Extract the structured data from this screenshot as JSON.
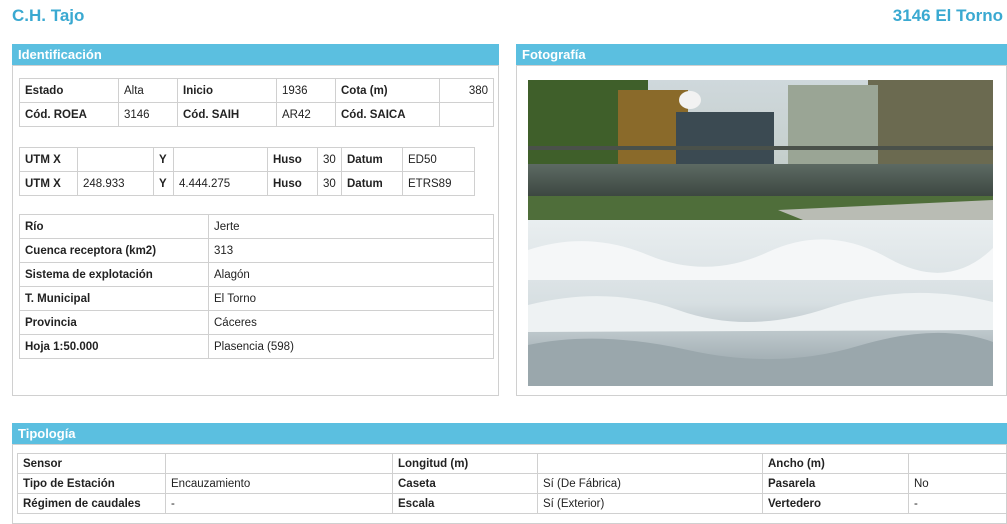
{
  "header": {
    "basin": "C.H. Tajo",
    "station": "3146 El Torno"
  },
  "identificacion": {
    "title": "Identificación",
    "row1": {
      "estado_label": "Estado",
      "estado": "Alta",
      "inicio_label": "Inicio",
      "inicio": "1936",
      "cota_label": "Cota (m)",
      "cota": "380"
    },
    "row2": {
      "roea_label": "Cód. ROEA",
      "roea": "3146",
      "saih_label": "Cód. SAIH",
      "saih": "AR42",
      "saica_label": "Cód. SAICA",
      "saica": ""
    },
    "utm1": {
      "x_label": "UTM X",
      "x": "",
      "y_label": "Y",
      "y": "",
      "huso_label": "Huso",
      "huso": "30",
      "datum_label": "Datum",
      "datum": "ED50"
    },
    "utm2": {
      "x_label": "UTM X",
      "x": "248.933",
      "y_label": "Y",
      "y": "4.444.275",
      "huso_label": "Huso",
      "huso": "30",
      "datum_label": "Datum",
      "datum": "ETRS89"
    },
    "info": [
      {
        "label": "Río",
        "value": "Jerte"
      },
      {
        "label": "Cuenca receptora (km2)",
        "value": "313"
      },
      {
        "label": "Sistema de explotación",
        "value": "Alagón"
      },
      {
        "label": "T. Municipal",
        "value": "El Torno"
      },
      {
        "label": "Provincia",
        "value": "Cáceres"
      },
      {
        "label": "Hoja 1:50.000",
        "value": "Plasencia (598)"
      }
    ]
  },
  "fotografia": {
    "title": "Fotografía"
  },
  "tipologia": {
    "title": "Tipología",
    "rows": [
      [
        "Sensor",
        "",
        "Longitud (m)",
        "",
        "Ancho (m)",
        ""
      ],
      [
        "Tipo de Estación",
        "Encauzamiento",
        "Caseta",
        "Sí (De Fábrica)",
        "Pasarela",
        "No"
      ],
      [
        "Régimen de caudales",
        "-",
        "Escala",
        "Sí (Exterior)",
        "Vertedero",
        "-"
      ]
    ]
  },
  "colors": {
    "accent": "#5bbfe0",
    "title_text": "#3aa9d1"
  }
}
